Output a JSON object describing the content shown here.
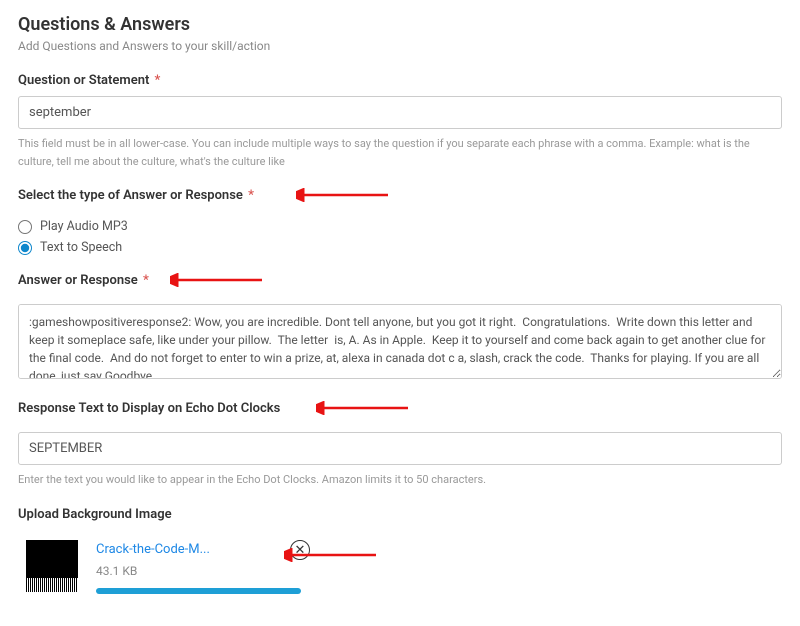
{
  "header": {
    "title": "Questions & Answers",
    "subtitle": "Add Questions and Answers to your skill/action"
  },
  "question": {
    "label": "Question or Statement",
    "value": "september",
    "help": "This field must be in all lower-case. You can include multiple ways to say the question if you separate each phrase with a comma. Example: what is the culture, tell me about the culture, what's the culture like"
  },
  "responseType": {
    "label": "Select the type of Answer or Response",
    "options": {
      "audio": "Play Audio MP3",
      "tts": "Text to Speech"
    }
  },
  "answer": {
    "label": "Answer or Response",
    "value": ":gameshowpositiveresponse2: Wow, you are incredible. Dont tell anyone, but you got it right.  Congratulations.  Write down this letter and keep it someplace safe, like under your pillow.  The letter  is, A. As in Apple.  Keep it to yourself and come back again to get another clue for the final code.  And do not forget to enter to win a prize, at, alexa in canada dot c a, slash, crack the code.  Thanks for playing. If you are all done, just say Goodbye."
  },
  "displayText": {
    "label": "Response Text to Display on Echo Dot Clocks",
    "value": "SEPTEMBER",
    "help": "Enter the text you would like to appear in the Echo Dot Clocks. Amazon limits it to 50 characters."
  },
  "upload": {
    "label": "Upload Background Image",
    "fileName": "Crack-the-Code-M...",
    "fileSize": "43.1 KB"
  }
}
